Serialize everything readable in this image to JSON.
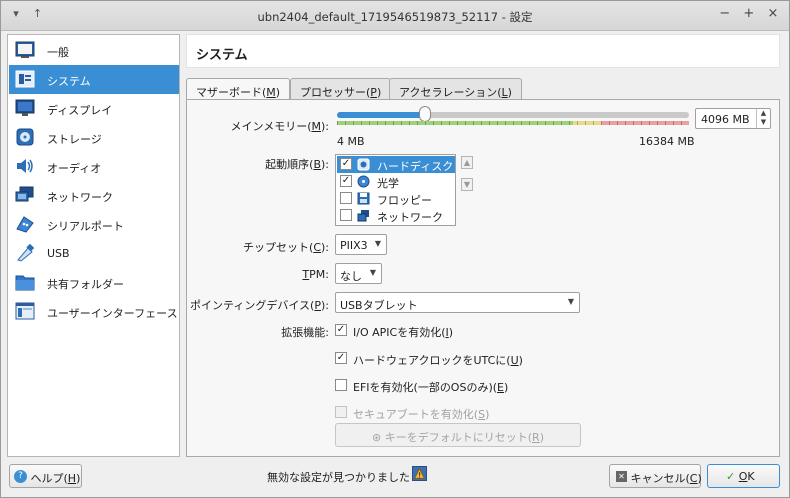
{
  "window": {
    "title": "ubn2404_default_1719546519873_52117 - 設定",
    "left_controls": [
      "▾",
      "↑"
    ],
    "right_controls": [
      "−",
      "+",
      "×"
    ]
  },
  "sidebar": {
    "items": [
      {
        "label": "一般",
        "icon": "general-icon"
      },
      {
        "label": "システム",
        "icon": "system-icon",
        "selected": true
      },
      {
        "label": "ディスプレイ",
        "icon": "display-icon"
      },
      {
        "label": "ストレージ",
        "icon": "storage-icon"
      },
      {
        "label": "オーディオ",
        "icon": "audio-icon"
      },
      {
        "label": "ネットワーク",
        "icon": "network-icon"
      },
      {
        "label": "シリアルポート",
        "icon": "serial-port-icon"
      },
      {
        "label": "USB",
        "icon": "usb-icon"
      },
      {
        "label": "共有フォルダー",
        "icon": "shared-folder-icon"
      },
      {
        "label": "ユーザーインターフェース",
        "icon": "user-interface-icon"
      }
    ]
  },
  "header": {
    "title": "システム"
  },
  "tabs": [
    {
      "text": "マザーボード(",
      "key": "M",
      "end": ")",
      "active": true
    },
    {
      "text": "プロセッサー(",
      "key": "P",
      "end": ")"
    },
    {
      "text": "アクセラレーション(",
      "key": "L",
      "end": ")"
    }
  ],
  "memory": {
    "label_pre": "メインメモリー(",
    "label_key": "M",
    "label_post": "):",
    "value": "4096 MB",
    "min_label": "4 MB",
    "max_label": "16384 MB",
    "fraction": 0.25
  },
  "boot": {
    "label_pre": "起動順序(",
    "label_key": "B",
    "label_post": "):",
    "items": [
      {
        "label": "ハードディスク",
        "checked": true,
        "icon": "hard-disk-icon",
        "selected": true
      },
      {
        "label": "光学",
        "checked": true,
        "icon": "optical-disc-icon"
      },
      {
        "label": "フロッピー",
        "checked": false,
        "icon": "floppy-icon"
      },
      {
        "label": "ネットワーク",
        "checked": false,
        "icon": "network-boot-icon"
      }
    ]
  },
  "chipset": {
    "label_pre": "チップセット(",
    "label_key": "C",
    "label_post": "):",
    "value": "PIIX3"
  },
  "tpm": {
    "label_key": "T",
    "label_post": "PM:",
    "value": "なし"
  },
  "pointing": {
    "label_pre": "ポインティングデバイス(",
    "label_key": "P",
    "label_post": "):",
    "value": "USBタブレット"
  },
  "features": {
    "label": "拡張機能:",
    "ioapic": {
      "pre": "I/O APICを有効化(",
      "key": "I",
      "post": ")",
      "checked": true
    },
    "utc": {
      "pre": "ハードウェアクロックをUTCに(",
      "key": "U",
      "post": ")",
      "checked": true
    },
    "efi": {
      "pre": "EFIを有効化(一部のOSのみ)(",
      "key": "E",
      "post": ")",
      "checked": false
    },
    "secureboot": {
      "pre": "セキュアブートを有効化(",
      "key": "S",
      "post": ")",
      "checked": false
    }
  },
  "reset_button": {
    "pre": "キーをデフォルトにリセット(",
    "key": "R",
    "post": ")"
  },
  "footer": {
    "help": {
      "pre": "ヘルプ(",
      "key": "H",
      "post": ")"
    },
    "status": "無効な設定が見つかりました",
    "cancel": {
      "pre": "キャンセル(",
      "key": "C",
      "post": ")"
    },
    "ok": {
      "key": "O",
      "post": "K"
    }
  },
  "colors": {
    "accent": "#3a8ed4",
    "scale_green": "#9ed27a",
    "scale_yellow": "#e6dc8a",
    "scale_red": "#eaa0a0"
  }
}
